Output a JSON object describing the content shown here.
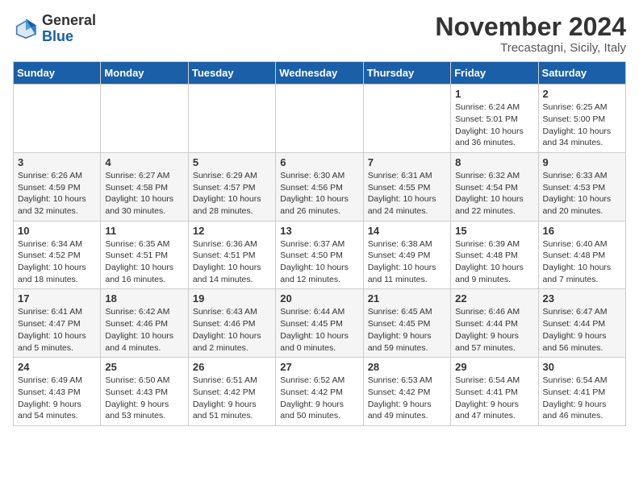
{
  "header": {
    "logo_general": "General",
    "logo_blue": "Blue",
    "month_title": "November 2024",
    "location": "Trecastagni, Sicily, Italy"
  },
  "days_of_week": [
    "Sunday",
    "Monday",
    "Tuesday",
    "Wednesday",
    "Thursday",
    "Friday",
    "Saturday"
  ],
  "weeks": [
    [
      {
        "day": "",
        "info": ""
      },
      {
        "day": "",
        "info": ""
      },
      {
        "day": "",
        "info": ""
      },
      {
        "day": "",
        "info": ""
      },
      {
        "day": "",
        "info": ""
      },
      {
        "day": "1",
        "info": "Sunrise: 6:24 AM\nSunset: 5:01 PM\nDaylight: 10 hours and 36 minutes."
      },
      {
        "day": "2",
        "info": "Sunrise: 6:25 AM\nSunset: 5:00 PM\nDaylight: 10 hours and 34 minutes."
      }
    ],
    [
      {
        "day": "3",
        "info": "Sunrise: 6:26 AM\nSunset: 4:59 PM\nDaylight: 10 hours and 32 minutes."
      },
      {
        "day": "4",
        "info": "Sunrise: 6:27 AM\nSunset: 4:58 PM\nDaylight: 10 hours and 30 minutes."
      },
      {
        "day": "5",
        "info": "Sunrise: 6:29 AM\nSunset: 4:57 PM\nDaylight: 10 hours and 28 minutes."
      },
      {
        "day": "6",
        "info": "Sunrise: 6:30 AM\nSunset: 4:56 PM\nDaylight: 10 hours and 26 minutes."
      },
      {
        "day": "7",
        "info": "Sunrise: 6:31 AM\nSunset: 4:55 PM\nDaylight: 10 hours and 24 minutes."
      },
      {
        "day": "8",
        "info": "Sunrise: 6:32 AM\nSunset: 4:54 PM\nDaylight: 10 hours and 22 minutes."
      },
      {
        "day": "9",
        "info": "Sunrise: 6:33 AM\nSunset: 4:53 PM\nDaylight: 10 hours and 20 minutes."
      }
    ],
    [
      {
        "day": "10",
        "info": "Sunrise: 6:34 AM\nSunset: 4:52 PM\nDaylight: 10 hours and 18 minutes."
      },
      {
        "day": "11",
        "info": "Sunrise: 6:35 AM\nSunset: 4:51 PM\nDaylight: 10 hours and 16 minutes."
      },
      {
        "day": "12",
        "info": "Sunrise: 6:36 AM\nSunset: 4:51 PM\nDaylight: 10 hours and 14 minutes."
      },
      {
        "day": "13",
        "info": "Sunrise: 6:37 AM\nSunset: 4:50 PM\nDaylight: 10 hours and 12 minutes."
      },
      {
        "day": "14",
        "info": "Sunrise: 6:38 AM\nSunset: 4:49 PM\nDaylight: 10 hours and 11 minutes."
      },
      {
        "day": "15",
        "info": "Sunrise: 6:39 AM\nSunset: 4:48 PM\nDaylight: 10 hours and 9 minutes."
      },
      {
        "day": "16",
        "info": "Sunrise: 6:40 AM\nSunset: 4:48 PM\nDaylight: 10 hours and 7 minutes."
      }
    ],
    [
      {
        "day": "17",
        "info": "Sunrise: 6:41 AM\nSunset: 4:47 PM\nDaylight: 10 hours and 5 minutes."
      },
      {
        "day": "18",
        "info": "Sunrise: 6:42 AM\nSunset: 4:46 PM\nDaylight: 10 hours and 4 minutes."
      },
      {
        "day": "19",
        "info": "Sunrise: 6:43 AM\nSunset: 4:46 PM\nDaylight: 10 hours and 2 minutes."
      },
      {
        "day": "20",
        "info": "Sunrise: 6:44 AM\nSunset: 4:45 PM\nDaylight: 10 hours and 0 minutes."
      },
      {
        "day": "21",
        "info": "Sunrise: 6:45 AM\nSunset: 4:45 PM\nDaylight: 9 hours and 59 minutes."
      },
      {
        "day": "22",
        "info": "Sunrise: 6:46 AM\nSunset: 4:44 PM\nDaylight: 9 hours and 57 minutes."
      },
      {
        "day": "23",
        "info": "Sunrise: 6:47 AM\nSunset: 4:44 PM\nDaylight: 9 hours and 56 minutes."
      }
    ],
    [
      {
        "day": "24",
        "info": "Sunrise: 6:49 AM\nSunset: 4:43 PM\nDaylight: 9 hours and 54 minutes."
      },
      {
        "day": "25",
        "info": "Sunrise: 6:50 AM\nSunset: 4:43 PM\nDaylight: 9 hours and 53 minutes."
      },
      {
        "day": "26",
        "info": "Sunrise: 6:51 AM\nSunset: 4:42 PM\nDaylight: 9 hours and 51 minutes."
      },
      {
        "day": "27",
        "info": "Sunrise: 6:52 AM\nSunset: 4:42 PM\nDaylight: 9 hours and 50 minutes."
      },
      {
        "day": "28",
        "info": "Sunrise: 6:53 AM\nSunset: 4:42 PM\nDaylight: 9 hours and 49 minutes."
      },
      {
        "day": "29",
        "info": "Sunrise: 6:54 AM\nSunset: 4:41 PM\nDaylight: 9 hours and 47 minutes."
      },
      {
        "day": "30",
        "info": "Sunrise: 6:54 AM\nSunset: 4:41 PM\nDaylight: 9 hours and 46 minutes."
      }
    ]
  ]
}
